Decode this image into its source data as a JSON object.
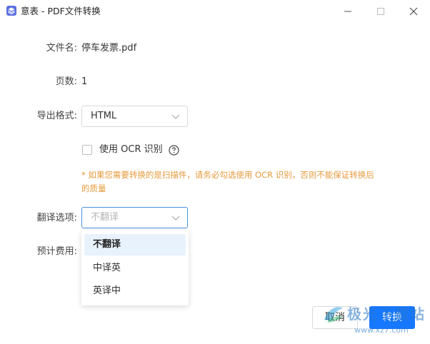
{
  "window": {
    "title": "意表 - PDF文件转换",
    "icon": "layers-icon"
  },
  "form": {
    "filename_label": "文件名:",
    "filename_value": "停车发票.pdf",
    "pages_label": "页数:",
    "pages_value": "1",
    "format_label": "导出格式:",
    "format_value": "HTML",
    "ocr_label": "使用 OCR 识别",
    "ocr_checked": false,
    "warning": "* 如果您需要转换的是扫描件，请务必勾选使用 OCR 识别，否则不能保证转换后的质量",
    "translate_label": "翻译选项:",
    "translate_placeholder": "不翻译",
    "cost_label": "预计费用:"
  },
  "dropdown": {
    "options": [
      "不翻译",
      "中译英",
      "英译中"
    ],
    "selected_index": 0
  },
  "buttons": {
    "cancel": "取消",
    "convert": "转换"
  },
  "watermark": {
    "text": "极光下载站",
    "url": "www.xz7.com"
  },
  "colors": {
    "primary": "#1677ff",
    "warning": "#e69a3c",
    "selected_bg": "#e8f2fd",
    "focus_border": "#4a90e2"
  }
}
